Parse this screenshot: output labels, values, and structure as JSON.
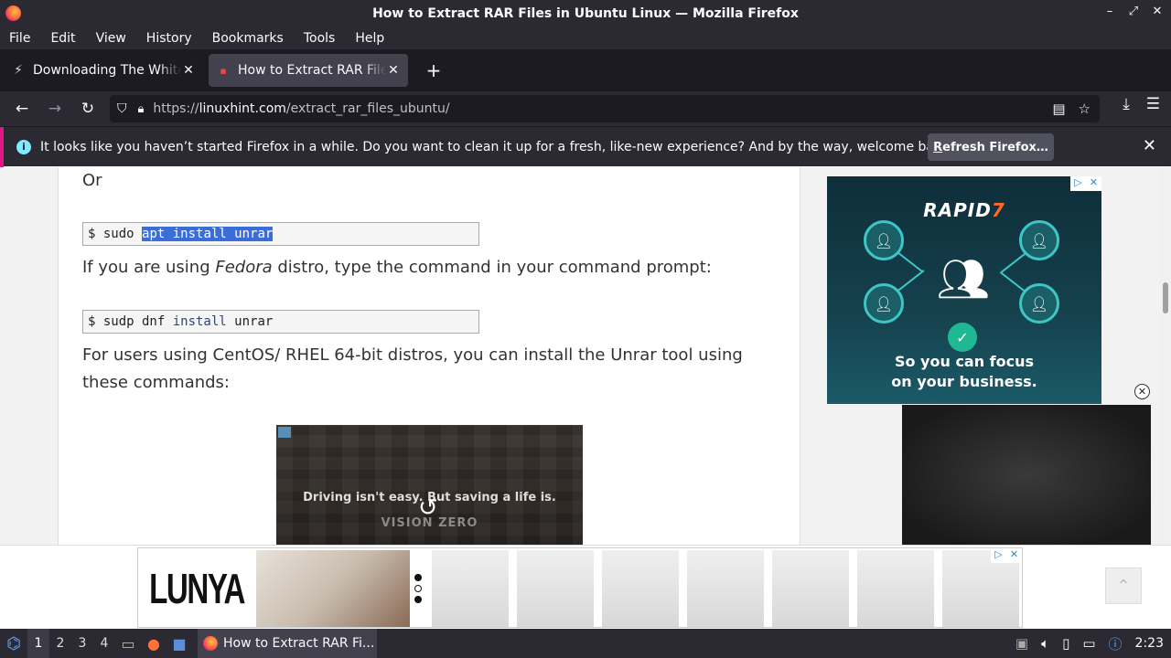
{
  "window": {
    "title": "How to Extract RAR Files in Ubuntu Linux — Mozilla Firefox"
  },
  "menu": [
    "File",
    "Edit",
    "View",
    "History",
    "Bookmarks",
    "Tools",
    "Help"
  ],
  "tabs": [
    {
      "label": "Downloading The White House",
      "active": false
    },
    {
      "label": "How to Extract RAR Files in Ubuntu Linux",
      "active": true
    }
  ],
  "nav": {
    "url_prefix": "https://",
    "url_domain": "linuxhint.com",
    "url_path": "/extract_rar_files_ubuntu/"
  },
  "notification": {
    "message": "It looks like you haven’t started Firefox in a while. Do you want to clean it up for a fresh, like-new experience? And by the way, welcome back!",
    "button_prefix": "R",
    "button_rest": "efresh Firefox…"
  },
  "article": {
    "or_text": "Or",
    "cmd1": {
      "prompt": "$ sudo ",
      "selected": "apt install unrar"
    },
    "fedora_pre": "If you are using ",
    "fedora_em": "Fedora",
    "fedora_post": " distro, type the command in your command prompt:",
    "cmd2": {
      "prompt": "$ sudp dnf ",
      "kw": "install",
      "rest": " unrar"
    },
    "centos_line1": "For users using CentOS/ RHEL 64-bit distros, you can install the Unrar tool using",
    "centos_line2": "these commands:"
  },
  "video_ad": {
    "caption": "Driving isn't easy. But saving a life is.",
    "brand": "VISION ZERO"
  },
  "side_ad": {
    "brand_main": "RAPID",
    "brand_accent": "7",
    "tagline1": "So you can focus",
    "tagline2": "on your business."
  },
  "bottom_ad": {
    "brand": "LUNYA"
  },
  "taskbar": {
    "workspaces": [
      "1",
      "2",
      "3",
      "4"
    ],
    "task_label": "How to Extract RAR Fi...",
    "clock": "2:23"
  },
  "colors": {
    "chrome": "#2b2a33",
    "tab_bg": "#1c1b22",
    "selection": "#3a6dd8",
    "notice_accent": "#e31587"
  }
}
